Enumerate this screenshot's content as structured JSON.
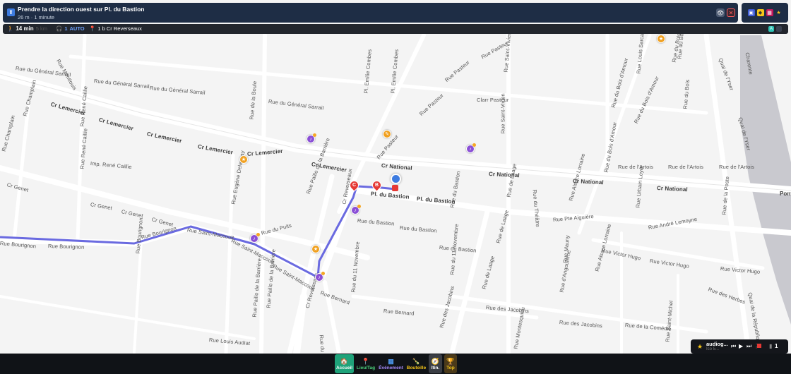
{
  "banner": {
    "instruction": "Prendre la direction ouest sur Pl. du Bastion",
    "distance_time": "26 m · 1 minute",
    "direction_icon": "up-arrow-icon",
    "view_icon": "eye-icon",
    "close_label": "✕"
  },
  "top_right": {
    "icons": [
      "layers-icon",
      "tag-icon",
      "calendar-icon",
      "star-icon"
    ]
  },
  "infobar": {
    "duration": "14 min",
    "duration_alt": "5 km",
    "passengers": "1",
    "mode": "AUTO",
    "destination": "1 b Cr Reverseaux",
    "badge": "A"
  },
  "map": {
    "streets": [
      {
        "t": "Rue du Général Sarrail",
        "id": "s1"
      },
      {
        "t": "Rue du Général Sarrail",
        "id": "s2"
      },
      {
        "t": "Rue du Général Sarrail",
        "id": "s3"
      },
      {
        "t": "Rue du Général Sarrail",
        "id": "s4"
      },
      {
        "t": "Rue Montlouis",
        "id": "s5"
      },
      {
        "t": "Rue Pasteur",
        "id": "s6"
      },
      {
        "t": "Rue Pasteur",
        "id": "s7"
      },
      {
        "t": "Rue Pasteur",
        "id": "s8"
      },
      {
        "t": "Rue Pasteur",
        "id": "s9"
      },
      {
        "t": "Rue Saint-Vivien",
        "id": "s10"
      },
      {
        "t": "Rue Saint-Vivien",
        "id": "s11"
      },
      {
        "t": "Rue du Bois d'Amour",
        "id": "s12"
      },
      {
        "t": "Rue du Bois d'Amour",
        "id": "s13"
      },
      {
        "t": "Rue du Bois d'Amour",
        "id": "s14"
      },
      {
        "t": "Rue Louis Sarcan",
        "id": "s15"
      },
      {
        "t": "Rue du Bois",
        "id": "s16"
      },
      {
        "t": "Rue du Bois",
        "id": "s17"
      },
      {
        "t": "Rue du Bois",
        "id": "s18"
      },
      {
        "t": "Quai de l'Yser",
        "id": "s19"
      },
      {
        "t": "Quai de l'Yser",
        "id": "s20"
      },
      {
        "t": "Cr Lemercier",
        "id": "s21"
      },
      {
        "t": "Cr Lemercier",
        "id": "s22"
      },
      {
        "t": "Cr Lemercier",
        "id": "s23"
      },
      {
        "t": "Cr Lemercier",
        "id": "s24"
      },
      {
        "t": "Cr Lemercier",
        "id": "s25"
      },
      {
        "t": "Cr Lemercier",
        "id": "s26"
      },
      {
        "t": "Cr National",
        "id": "s27"
      },
      {
        "t": "Cr National",
        "id": "s28"
      },
      {
        "t": "Cr National",
        "id": "s29"
      },
      {
        "t": "Cr National",
        "id": "s30"
      },
      {
        "t": "Rue Champlain",
        "id": "s31"
      },
      {
        "t": "Rue Champlain",
        "id": "s32"
      },
      {
        "t": "Rue René Caillie",
        "id": "s33"
      },
      {
        "t": "Rue René Caillie",
        "id": "s34"
      },
      {
        "t": "Imp. René Caillie",
        "id": "s35"
      },
      {
        "t": "Cr Genet",
        "id": "s36"
      },
      {
        "t": "Cr Genet",
        "id": "s37"
      },
      {
        "t": "Cr Genet",
        "id": "s38"
      },
      {
        "t": "Cr Genet",
        "id": "s39"
      },
      {
        "t": "Rue de la Boule",
        "id": "s40"
      },
      {
        "t": "Rue Eugène Delaunay",
        "id": "s41"
      },
      {
        "t": "Rue Paillo de la Barrière",
        "id": "s42"
      },
      {
        "t": "Rue Paillo de la Barrière",
        "id": "s43"
      },
      {
        "t": "Rue du Puits",
        "id": "s44"
      },
      {
        "t": "Pl. Emilie Combes",
        "id": "s45"
      },
      {
        "t": "Pl. Emilie Combes",
        "id": "s46"
      },
      {
        "t": "Clarr Pasteur",
        "id": "s47"
      },
      {
        "t": "Pl. du Bastion",
        "id": "s48"
      },
      {
        "t": "Pl. du Bastion",
        "id": "s49"
      },
      {
        "t": "Rue du Bastion",
        "id": "s50"
      },
      {
        "t": "Rue du Bastion",
        "id": "s51"
      },
      {
        "t": "Rue du Bastion",
        "id": "s52"
      },
      {
        "t": "Rue du Bastion",
        "id": "s53"
      },
      {
        "t": "Rue de Laage",
        "id": "s54"
      },
      {
        "t": "Rue de Laage",
        "id": "s55"
      },
      {
        "t": "Rue de Laage",
        "id": "s56"
      },
      {
        "t": "Rue du Théâtre",
        "id": "s57"
      },
      {
        "t": "Rue Victor Hugo",
        "id": "s58"
      },
      {
        "t": "Rue Victor Hugo",
        "id": "s59"
      },
      {
        "t": "Rue Victor Hugo",
        "id": "s60"
      },
      {
        "t": "Rue de l'Artois",
        "id": "s61"
      },
      {
        "t": "Rue de l'Artois",
        "id": "s62"
      },
      {
        "t": "Rue de l'Artois",
        "id": "s63"
      },
      {
        "t": "Rue Bourignon",
        "id": "s64"
      },
      {
        "t": "Rue Bourignon",
        "id": "s65"
      },
      {
        "t": "Rue Bourignon",
        "id": "s66"
      },
      {
        "t": "Rue Bourignon",
        "id": "s67"
      },
      {
        "t": "Rue Saint-Maccoult",
        "id": "s68"
      },
      {
        "t": "Rue Saint-Maccoult",
        "id": "s69"
      },
      {
        "t": "Rue Saint-Maccoult",
        "id": "s70"
      },
      {
        "t": "Cr Reverseaux",
        "id": "s71"
      },
      {
        "t": "Cr Reverseaux",
        "id": "s72"
      },
      {
        "t": "Rue Bernard",
        "id": "s73"
      },
      {
        "t": "Rue Bernard",
        "id": "s74"
      },
      {
        "t": "Rue du 11 Novembre",
        "id": "s75"
      },
      {
        "t": "Rue du 11 Novembre",
        "id": "s76"
      },
      {
        "t": "Rue des Jacobins",
        "id": "s77"
      },
      {
        "t": "Rue des Jacobins",
        "id": "s78"
      },
      {
        "t": "Rue des Jacobins",
        "id": "s79"
      },
      {
        "t": "Rue Louis Audiat",
        "id": "s80"
      },
      {
        "t": "Rue Paillo de la Barrière",
        "id": "s81"
      },
      {
        "t": "Rue de la Comédie",
        "id": "s82"
      },
      {
        "t": "Rue Saint-Michel",
        "id": "s83"
      },
      {
        "t": "Rue Alsace Lorraine",
        "id": "s84"
      },
      {
        "t": "Rue Alsace Lorraine",
        "id": "s85"
      },
      {
        "t": "Rue Mauny",
        "id": "s86"
      },
      {
        "t": "Rue Montesquieu",
        "id": "s87"
      },
      {
        "t": "Rue d'Angoulême",
        "id": "s88"
      },
      {
        "t": "Rue Urbain Loyer",
        "id": "s89"
      },
      {
        "t": "Rue de la Poste",
        "id": "s90"
      },
      {
        "t": "Rue André Lemoyne",
        "id": "s91"
      },
      {
        "t": "Rue Pte Aiguière",
        "id": "s92"
      },
      {
        "t": "Quai de la République",
        "id": "s93"
      },
      {
        "t": "Pont",
        "id": "s94"
      },
      {
        "t": "Rue du 11 Novembre",
        "id": "s95"
      },
      {
        "t": "Rue des Herbes",
        "id": "s96"
      },
      {
        "t": "Charente",
        "id": "s97"
      }
    ],
    "markers": {
      "a": "C",
      "b": "B"
    },
    "start_icon": "location-pin-icon"
  },
  "audio": {
    "name": "audiog...",
    "sub": "Ico 5...",
    "count": "1"
  },
  "bottomnav": {
    "home": "Accueil",
    "place": "Lieu/Tag",
    "event": "Événement",
    "bottle": "Bouteille",
    "itin": "Itin.",
    "top": "Top"
  }
}
